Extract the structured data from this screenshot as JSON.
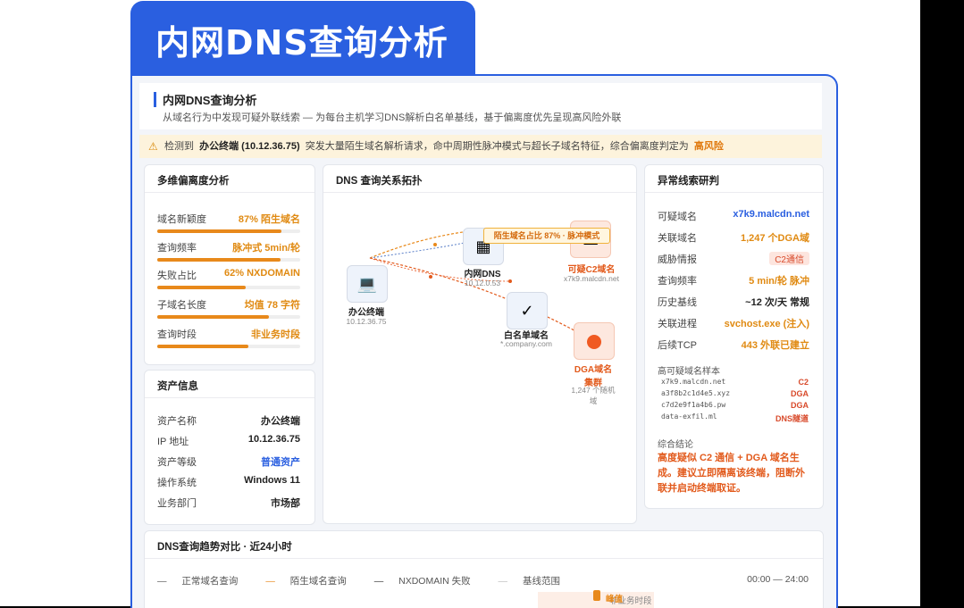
{
  "page_title": "内网DNS查询分析",
  "header": {
    "title": "内网DNS查询分析",
    "subtitle": "从域名行为中发现可疑外联线索 — 为每台主机学习DNS解析白名单基线，基于偏离度优先呈现高风险外联"
  },
  "alert": {
    "prefix": "检测到",
    "host": "办公终端 (10.12.36.75)",
    "body": "突发大量陌生域名解析请求，命中周期性脉冲模式与超长子域名特征，综合偏离度判定为",
    "level": "高风险"
  },
  "deviation": {
    "title": "多维偏离度分析",
    "metrics": [
      {
        "label": "域名新颖度",
        "value": "87% 陌生域名",
        "level": 0.87
      },
      {
        "label": "查询频率",
        "value": "脉冲式 5min/轮",
        "level": 0.86
      },
      {
        "label": "失败占比",
        "value": "62% NXDOMAIN",
        "level": 0.62
      },
      {
        "label": "子域名长度",
        "value": "均值 78 字符",
        "level": 0.78
      },
      {
        "label": "查询时段",
        "value": "非业务时段",
        "level": 0.64
      }
    ]
  },
  "asset": {
    "title": "资产信息",
    "rows": [
      {
        "k": "资产名称",
        "v": "办公终端"
      },
      {
        "k": "IP 地址",
        "v": "10.12.36.75"
      },
      {
        "k": "资产等级",
        "v": "普通资产"
      },
      {
        "k": "操作系统",
        "v": "Windows 11"
      },
      {
        "k": "业务部门",
        "v": "市场部"
      }
    ]
  },
  "topology": {
    "title": "DNS 查询关系拓扑",
    "tooltip": "陌生域名占比 87% · 脉冲模式",
    "nodes": {
      "office": {
        "label": "办公终端",
        "sub": "10.12.36.75"
      },
      "dns": {
        "label": "内网DNS",
        "sub": "10.12.0.53"
      },
      "c2": {
        "label": "可疑C2域名",
        "sub": "x7k9.malcdn.net"
      },
      "whitelist": {
        "label": "白名单域名",
        "sub": "*.company.com"
      },
      "dga": {
        "label": "DGA域名集群",
        "sub": "1,247 个随机域"
      }
    }
  },
  "clues": {
    "title": "异常线索研判",
    "rows": [
      {
        "k": "可疑域名",
        "v": "x7k9.malcdn.net"
      },
      {
        "k": "关联域名",
        "v": "1,247 个DGA域"
      },
      {
        "k": "威胁情报",
        "v": "C2通信"
      },
      {
        "k": "查询频率",
        "v": "5 min/轮 脉冲"
      },
      {
        "k": "历史基线",
        "v": "~12 次/天 常规"
      },
      {
        "k": "关联进程",
        "v": "svchost.exe (注入)"
      },
      {
        "k": "后续TCP",
        "v": "443 外联已建立"
      }
    ],
    "samples_title": "高可疑域名样本",
    "samples": [
      {
        "d": "x7k9.malcdn.net",
        "t": "C2"
      },
      {
        "d": "a3f8b2c1d4e5.xyz",
        "t": "DGA"
      },
      {
        "d": "c7d2e9f1a4b6.pw",
        "t": "DGA"
      },
      {
        "d": "data-exfil.ml",
        "t": "DNS隧道"
      }
    ],
    "conclusion_title": "综合结论",
    "conclusion": "高度疑似 C2 通信 + DGA 域名生成。建议立即隔离该终端，阻断外联并启动终端取证。"
  },
  "trend": {
    "title": "DNS查询趋势对比 · 近24小时",
    "legend": [
      "正常域名查询",
      "陌生域名查询",
      "NXDOMAIN 失败",
      "基线范围"
    ],
    "range": "00:00 — 24:00",
    "annotations": [
      "峰值",
      "非业务时段"
    ]
  },
  "colors": {
    "accent": "#2a5fe0",
    "warning": "#e8891b",
    "danger": "#e25a1c"
  }
}
